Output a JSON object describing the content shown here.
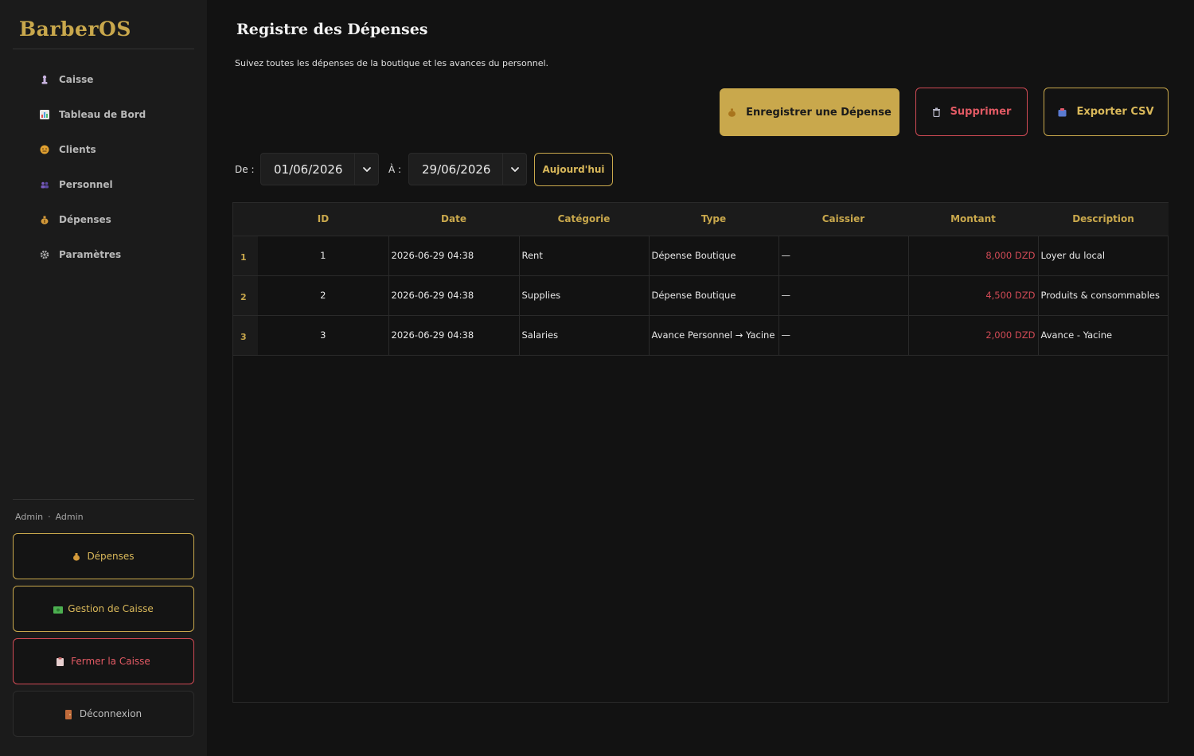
{
  "app": {
    "brand": "BarberOS"
  },
  "sidebar": {
    "items": [
      {
        "label": "Caisse",
        "icon": "pawn-icon",
        "color": "#c9b4e0"
      },
      {
        "label": "Tableau de Bord",
        "icon": "chart-icon",
        "color": "#5aa0e0"
      },
      {
        "label": "Clients",
        "icon": "face-icon",
        "color": "#e0a030"
      },
      {
        "label": "Personnel",
        "icon": "people-icon",
        "color": "#7a5cc0"
      },
      {
        "label": "Dépenses",
        "icon": "money-bag-icon",
        "color": "#d49a3a"
      },
      {
        "label": "Paramètres",
        "icon": "gear-icon",
        "color": "#b0b0b0"
      }
    ],
    "user": {
      "name": "Admin",
      "dot": "·",
      "role": "Admin"
    },
    "buttons": {
      "expenses": "Dépenses",
      "cash_management": "Gestion de Caisse",
      "close_cash": "Fermer la Caisse",
      "logout": "Déconnexion"
    }
  },
  "header": {
    "title": "Registre des Dépenses",
    "subtitle": "Suivez toutes les dépenses de la boutique et les avances du personnel."
  },
  "toolbar": {
    "record_label": "Enregistrer une Dépense",
    "delete_label": "Supprimer",
    "export_label": "Exporter CSV"
  },
  "filter": {
    "from_label": "De :",
    "from_value": "01/06/2026",
    "to_label": "À :",
    "to_value": "29/06/2026",
    "today_label": "Aujourd'hui"
  },
  "table": {
    "columns": [
      "ID",
      "Date",
      "Catégorie",
      "Type",
      "Caissier",
      "Montant",
      "Description"
    ],
    "rows": [
      {
        "num": "1",
        "id": "1",
        "date": "2026-06-29 04:38",
        "category": "Rent",
        "type": "Dépense Boutique",
        "cashier": "—",
        "amount": "8,000 DZD",
        "description": "Loyer du local"
      },
      {
        "num": "2",
        "id": "2",
        "date": "2026-06-29 04:38",
        "category": "Supplies",
        "type": "Dépense Boutique",
        "cashier": "—",
        "amount": "4,500 DZD",
        "description": "Produits & consommables"
      },
      {
        "num": "3",
        "id": "3",
        "date": "2026-06-29 04:38",
        "category": "Salaries",
        "type": "Avance Personnel → Yacine",
        "cashier": "—",
        "amount": "2,000 DZD",
        "description": "Avance - Yacine"
      }
    ]
  },
  "colors": {
    "accent": "#c9a84c",
    "danger": "#d04a55",
    "background": "#121212",
    "sidebar": "#1b1b1b"
  }
}
